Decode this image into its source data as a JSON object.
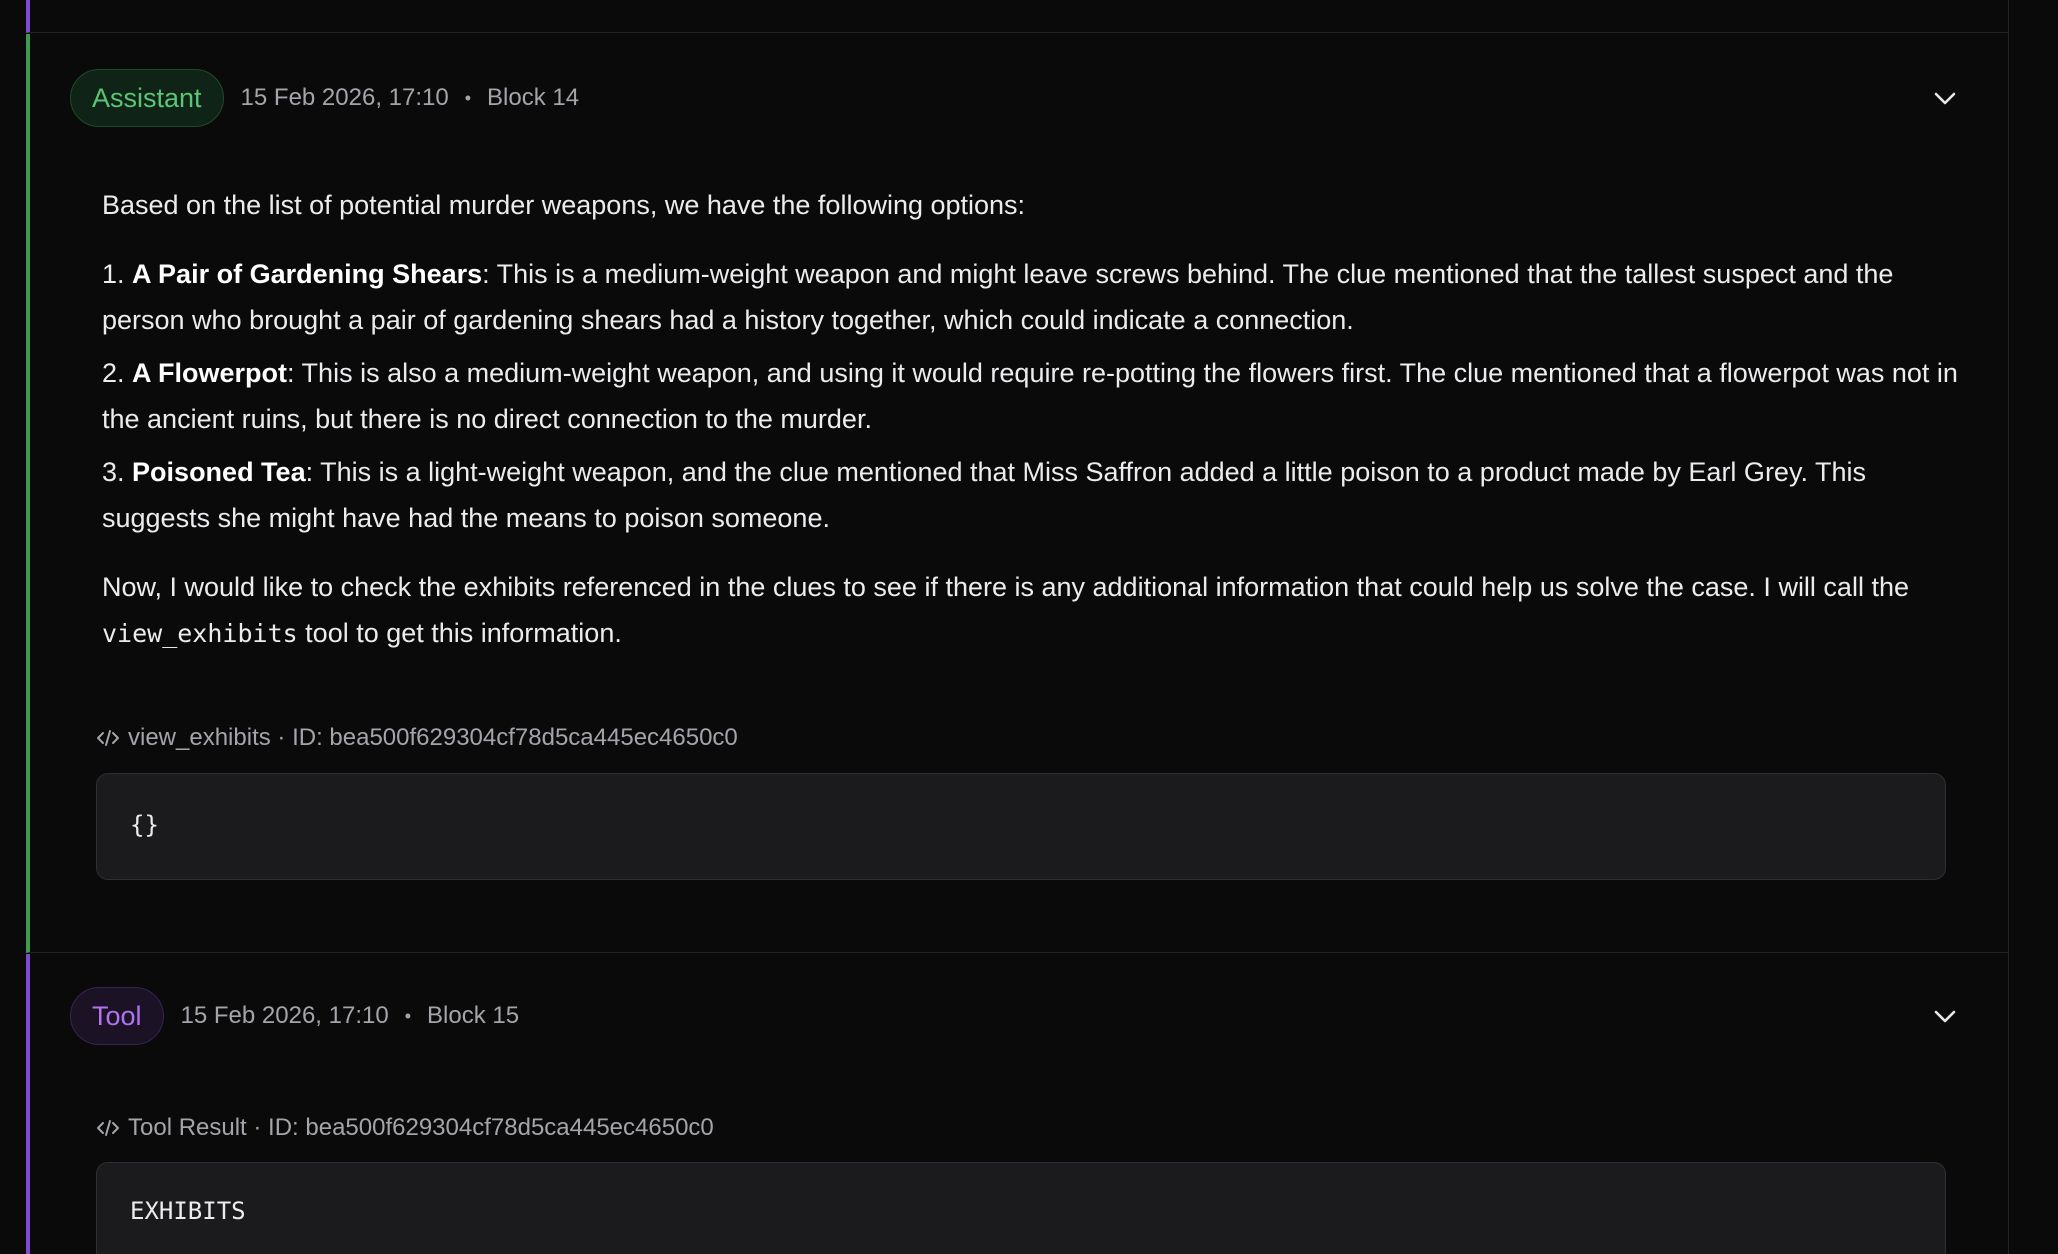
{
  "assistant_block": {
    "role": "Assistant",
    "timestamp": "15 Feb 2026, 17:10",
    "separator": "•",
    "block_label": "Block 14",
    "intro": "Based on the list of potential murder weapons, we have the following options:",
    "items": [
      {
        "number": "1.",
        "title": "A Pair of Gardening Shears",
        "text": ": This is a medium-weight weapon and might leave screws behind. The clue mentioned that the tallest suspect and the person who brought a pair of gardening shears had a history together, which could indicate a connection."
      },
      {
        "number": "2.",
        "title": "A Flowerpot",
        "text": ": This is also a medium-weight weapon, and using it would require re-potting the flowers first. The clue mentioned that a flowerpot was not in the ancient ruins, but there is no direct connection to the murder."
      },
      {
        "number": "3.",
        "title": "Poisoned Tea",
        "text": ": This is a light-weight weapon, and the clue mentioned that Miss Saffron added a little poison to a product made by Earl Grey. This suggests she might have had the means to poison someone."
      }
    ],
    "outro_before": "Now, I would like to check the exhibits referenced in the clues to see if there is any additional information that could help us solve the case. I will call the ",
    "outro_code": "view_exhibits",
    "outro_after": " tool to get this information.",
    "tool_call": {
      "label": "view_exhibits · ID: bea500f629304cf78d5ca445ec4650c0",
      "args": "{}"
    }
  },
  "tool_block": {
    "role": "Tool",
    "timestamp": "15 Feb 2026, 17:10",
    "separator": "•",
    "block_label": "Block 15",
    "result_label": "Tool Result · ID: bea500f629304cf78d5ca445ec4650c0",
    "result_text": "EXHIBITS"
  },
  "colors": {
    "assistant_accent": "#3e9a50",
    "assistant_badge_text": "#5cc476",
    "tool_accent": "#7c4dcc",
    "tool_badge_text": "#b174ef",
    "background": "#0a0a0b"
  },
  "icons": {
    "collapse": "chevron-down-icon",
    "code": "code-icon"
  }
}
